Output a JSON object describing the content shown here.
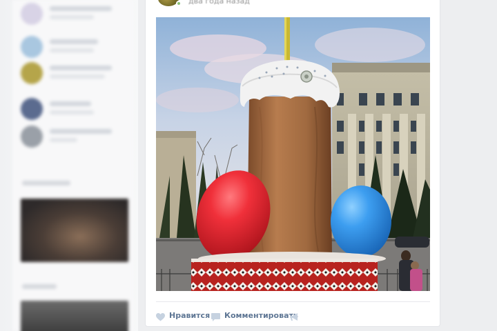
{
  "post": {
    "date": "два года назад",
    "actions": {
      "like_label": "Нравится",
      "comment_label": "Комментировать"
    }
  },
  "photo": {
    "subject": "giant Easter cake (paska) sculpture with red and blue eggs in city square"
  },
  "colors": {
    "page_bg": "#edeef0",
    "card_bg": "#ffffff",
    "action_text": "#5e7694",
    "red_egg": "#e4232b",
    "blue_egg": "#2f8fe0"
  },
  "icons": {
    "like": "heart-icon",
    "comment": "comment-icon",
    "share": "megaphone-icon"
  }
}
